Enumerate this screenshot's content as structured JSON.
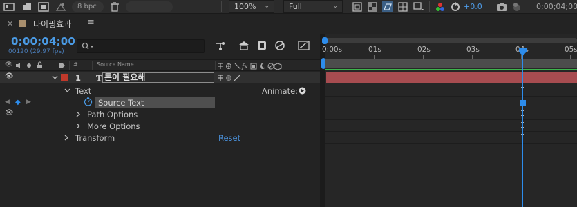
{
  "viewer_bar": {
    "bit_depth": "8 bpc",
    "zoom": "100%",
    "resolution": "Full",
    "exposure": "+0.0",
    "timecode": "0;00;04;00"
  },
  "panel": {
    "tab_title": "타이핑효과"
  },
  "timeline": {
    "current_time": "0;00;04;00",
    "frame_info": "00120 (29.97 fps)",
    "columns": {
      "hash": "#",
      "source_name": "Source Name"
    },
    "ruler": {
      "labels": [
        "0:00s",
        "01s",
        "02s",
        "03s",
        "04s",
        "05s"
      ]
    }
  },
  "layer": {
    "index": "1",
    "type_glyph": "T",
    "name": "돈이 필요해"
  },
  "properties": {
    "text": "Text",
    "animate": "Animate:",
    "source_text": "Source Text",
    "path_options": "Path Options",
    "more_options": "More Options",
    "transform": "Transform",
    "reset": "Reset"
  },
  "colors": {
    "accent": "#2d8ceb",
    "layer_label": "#c0392b",
    "layer_bar": "#a74c50",
    "work_area_line": "#3eb54d"
  }
}
